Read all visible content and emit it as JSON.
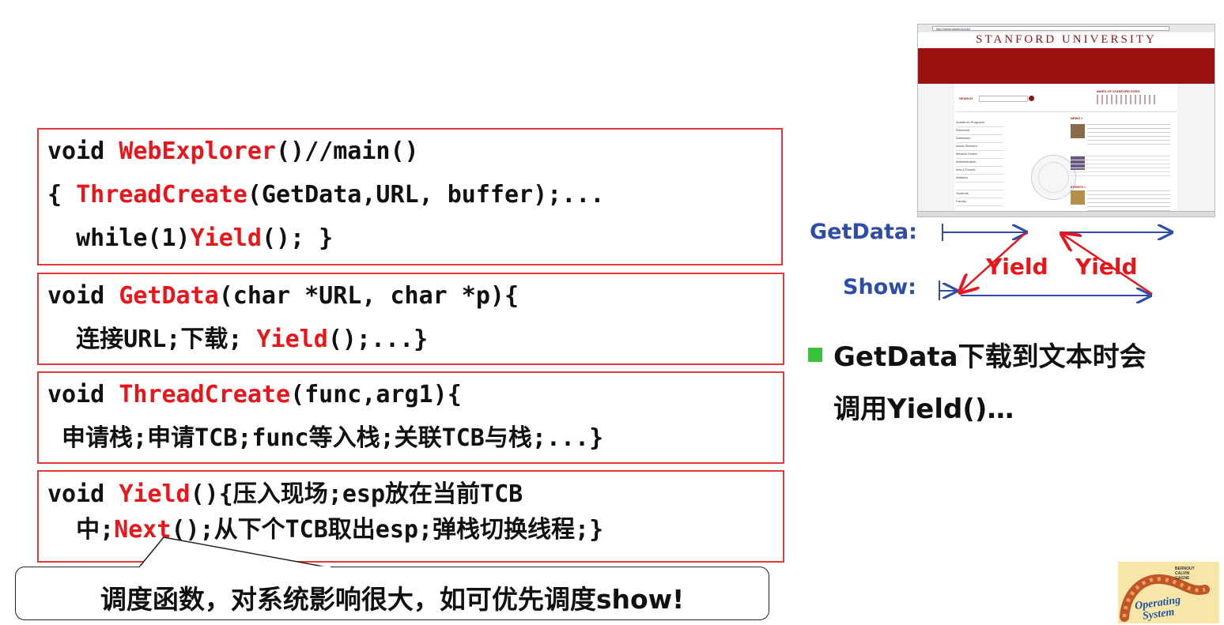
{
  "code_boxes": [
    {
      "lines": [
        [
          {
            "t": "void ",
            "c": "k"
          },
          {
            "t": "WebExplorer",
            "c": "r"
          },
          {
            "t": "()//main()",
            "c": "k"
          }
        ],
        [
          {
            "t": "{ ",
            "c": "k"
          },
          {
            "t": "ThreadCreate",
            "c": "r"
          },
          {
            "t": "(GetData,URL, buffer);...",
            "c": "k"
          }
        ],
        [
          {
            "t": "  while(1)",
            "c": "k"
          },
          {
            "t": "Yield",
            "c": "r"
          },
          {
            "t": "(); }",
            "c": "k"
          }
        ]
      ]
    },
    {
      "lines": [
        [
          {
            "t": "void ",
            "c": "k"
          },
          {
            "t": "GetData",
            "c": "r"
          },
          {
            "t": "(char *URL, char *p){",
            "c": "k"
          }
        ],
        [
          {
            "t": "  连接URL;下载; ",
            "c": "k"
          },
          {
            "t": "Yield",
            "c": "r"
          },
          {
            "t": "();...}",
            "c": "k"
          }
        ]
      ]
    },
    {
      "lines": [
        [
          {
            "t": "void ",
            "c": "k"
          },
          {
            "t": "ThreadCreate",
            "c": "r"
          },
          {
            "t": "(func,arg1){",
            "c": "k"
          }
        ],
        [
          {
            "t": " 申请栈;申请TCB;func等入栈;关联TCB与栈;...}",
            "c": "k"
          }
        ]
      ]
    },
    {
      "lines": [
        [
          {
            "t": "void ",
            "c": "k"
          },
          {
            "t": "Yield",
            "c": "r"
          },
          {
            "t": "(){压入现场;esp放在当前TCB",
            "c": "k"
          }
        ],
        [
          {
            "t": "  中;",
            "c": "k"
          },
          {
            "t": "Next",
            "c": "r"
          },
          {
            "t": "();从下个TCB取出esp;弹栈切换线程;}",
            "c": "k"
          }
        ]
      ]
    }
  ],
  "callout": "调度函数，对系统影响很大，如可优先调度show!",
  "diagram": {
    "getdata_label": "GetData:",
    "show_label": "Show:",
    "yield_left": "Yield",
    "yield_right": "Yield"
  },
  "bullet": {
    "line1": "GetData下载到文本时会",
    "line2": "调用Yield()…"
  },
  "browser": {
    "url": "http://www.stanford.edu/",
    "title": "STANFORD UNIVERSITY",
    "search_label": "SEARCH",
    "index_label": "INDEX OF STANFORD SITES",
    "news_label": "NEWS »",
    "events_label": "EVENTS »",
    "sidebar": [
      "Academic Programs",
      "Research",
      "Admission",
      "About Stanford",
      "Medical Center",
      "Administration",
      "Arts & Events",
      "Athletics",
      "",
      "Students",
      "Faculty"
    ]
  },
  "logo": {
    "line1": "Operating",
    "line2": "System"
  },
  "colors": {
    "accent_red": "#e8161b",
    "box_border": "#e23a3a",
    "diagram_blue": "#2e4da6",
    "bullet_green": "#3bc23b"
  }
}
